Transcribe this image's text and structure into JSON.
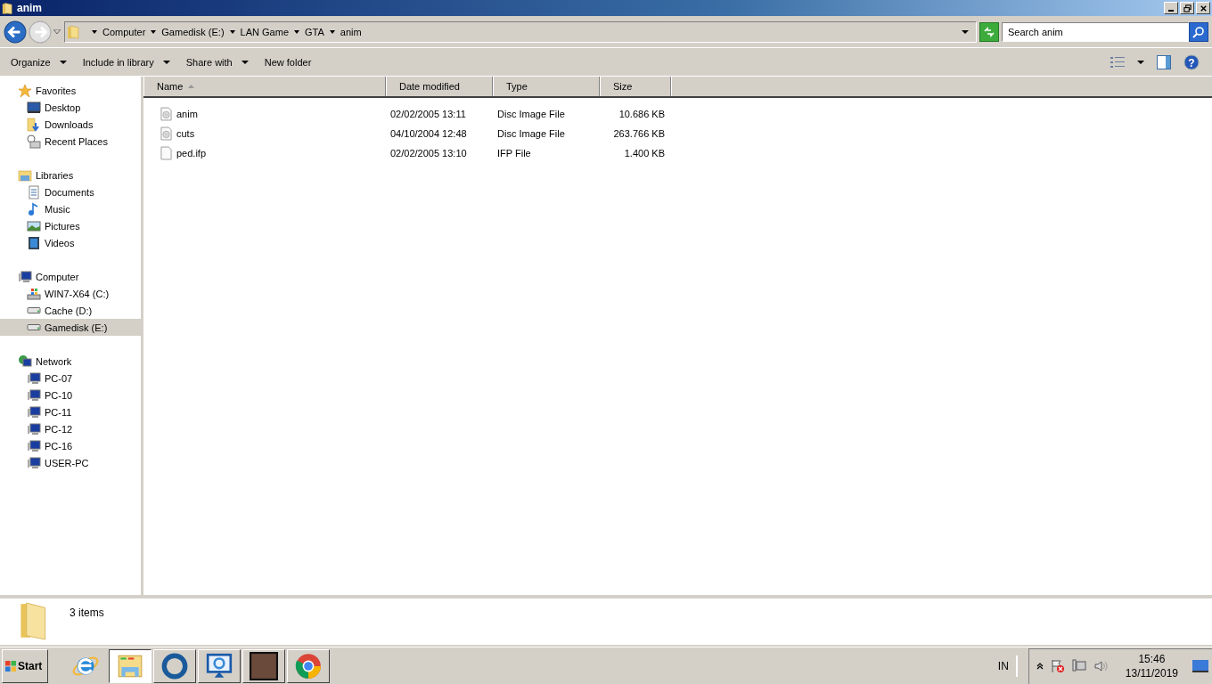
{
  "window": {
    "title": "anim"
  },
  "address_bar": {
    "path": [
      "Computer",
      "Gamedisk (E:)",
      "LAN Game",
      "GTA",
      "anim"
    ]
  },
  "search": {
    "placeholder": "Search anim"
  },
  "toolbar": {
    "commands": [
      {
        "label": "Organize",
        "dropdown": true
      },
      {
        "label": "Include in library",
        "dropdown": true
      },
      {
        "label": "Share with",
        "dropdown": true
      },
      {
        "label": "New folder",
        "dropdown": false
      }
    ],
    "help": "?"
  },
  "sidebar": {
    "groups": [
      {
        "label": "Favorites",
        "kind": "star",
        "selected": false,
        "children": [
          {
            "label": "Desktop",
            "kind": "desktop",
            "selected": false
          },
          {
            "label": "Downloads",
            "kind": "downloads",
            "selected": false
          },
          {
            "label": "Recent Places",
            "kind": "recent",
            "selected": false
          }
        ]
      },
      {
        "label": "Libraries",
        "kind": "library",
        "selected": false,
        "children": [
          {
            "label": "Documents",
            "kind": "document",
            "selected": false
          },
          {
            "label": "Music",
            "kind": "music",
            "selected": false
          },
          {
            "label": "Pictures",
            "kind": "picture",
            "selected": false
          },
          {
            "label": "Videos",
            "kind": "video",
            "selected": false
          }
        ]
      },
      {
        "label": "Computer",
        "kind": "computer",
        "selected": false,
        "children": [
          {
            "label": "WIN7-X64 (C:)",
            "kind": "system-drive",
            "selected": false
          },
          {
            "label": "Cache (D:)",
            "kind": "drive",
            "selected": false
          },
          {
            "label": "Gamedisk (E:)",
            "kind": "drive",
            "selected": true
          }
        ]
      },
      {
        "label": "Network",
        "kind": "network",
        "selected": false,
        "children": [
          {
            "label": "PC-07",
            "kind": "computer",
            "selected": false
          },
          {
            "label": "PC-10",
            "kind": "computer",
            "selected": false
          },
          {
            "label": "PC-11",
            "kind": "computer",
            "selected": false
          },
          {
            "label": "PC-12",
            "kind": "computer",
            "selected": false
          },
          {
            "label": "PC-16",
            "kind": "computer",
            "selected": false
          },
          {
            "label": "USER-PC",
            "kind": "computer",
            "selected": false
          }
        ]
      }
    ]
  },
  "table": {
    "columns": [
      {
        "label": "Name",
        "sorted": true
      },
      {
        "label": "Date modified",
        "sorted": false
      },
      {
        "label": "Type",
        "sorted": false
      },
      {
        "label": "Size",
        "sorted": false
      }
    ],
    "rows": [
      {
        "kind": "disc",
        "name": "anim",
        "date": "02/02/2005 13:11",
        "type": "Disc Image File",
        "size": "10.686 KB"
      },
      {
        "kind": "disc",
        "name": "cuts",
        "date": "04/10/2004 12:48",
        "type": "Disc Image File",
        "size": "263.766 KB"
      },
      {
        "kind": "file",
        "name": "ped.ifp",
        "date": "02/02/2005 13:10",
        "type": "IFP File",
        "size": "1.400 KB"
      }
    ]
  },
  "details_pane": {
    "count": "3 items"
  },
  "taskbar": {
    "start": "Start",
    "apps": [
      {
        "kind": "browser-e",
        "selected": false
      },
      {
        "kind": "explorer",
        "selected": true
      },
      {
        "kind": "ring",
        "selected": false
      },
      {
        "kind": "monitor",
        "selected": false
      },
      {
        "kind": "photo",
        "selected": false
      },
      {
        "kind": "chrome",
        "selected": false
      }
    ],
    "language": "IN",
    "time": "15:46",
    "date": "13/11/2019"
  }
}
